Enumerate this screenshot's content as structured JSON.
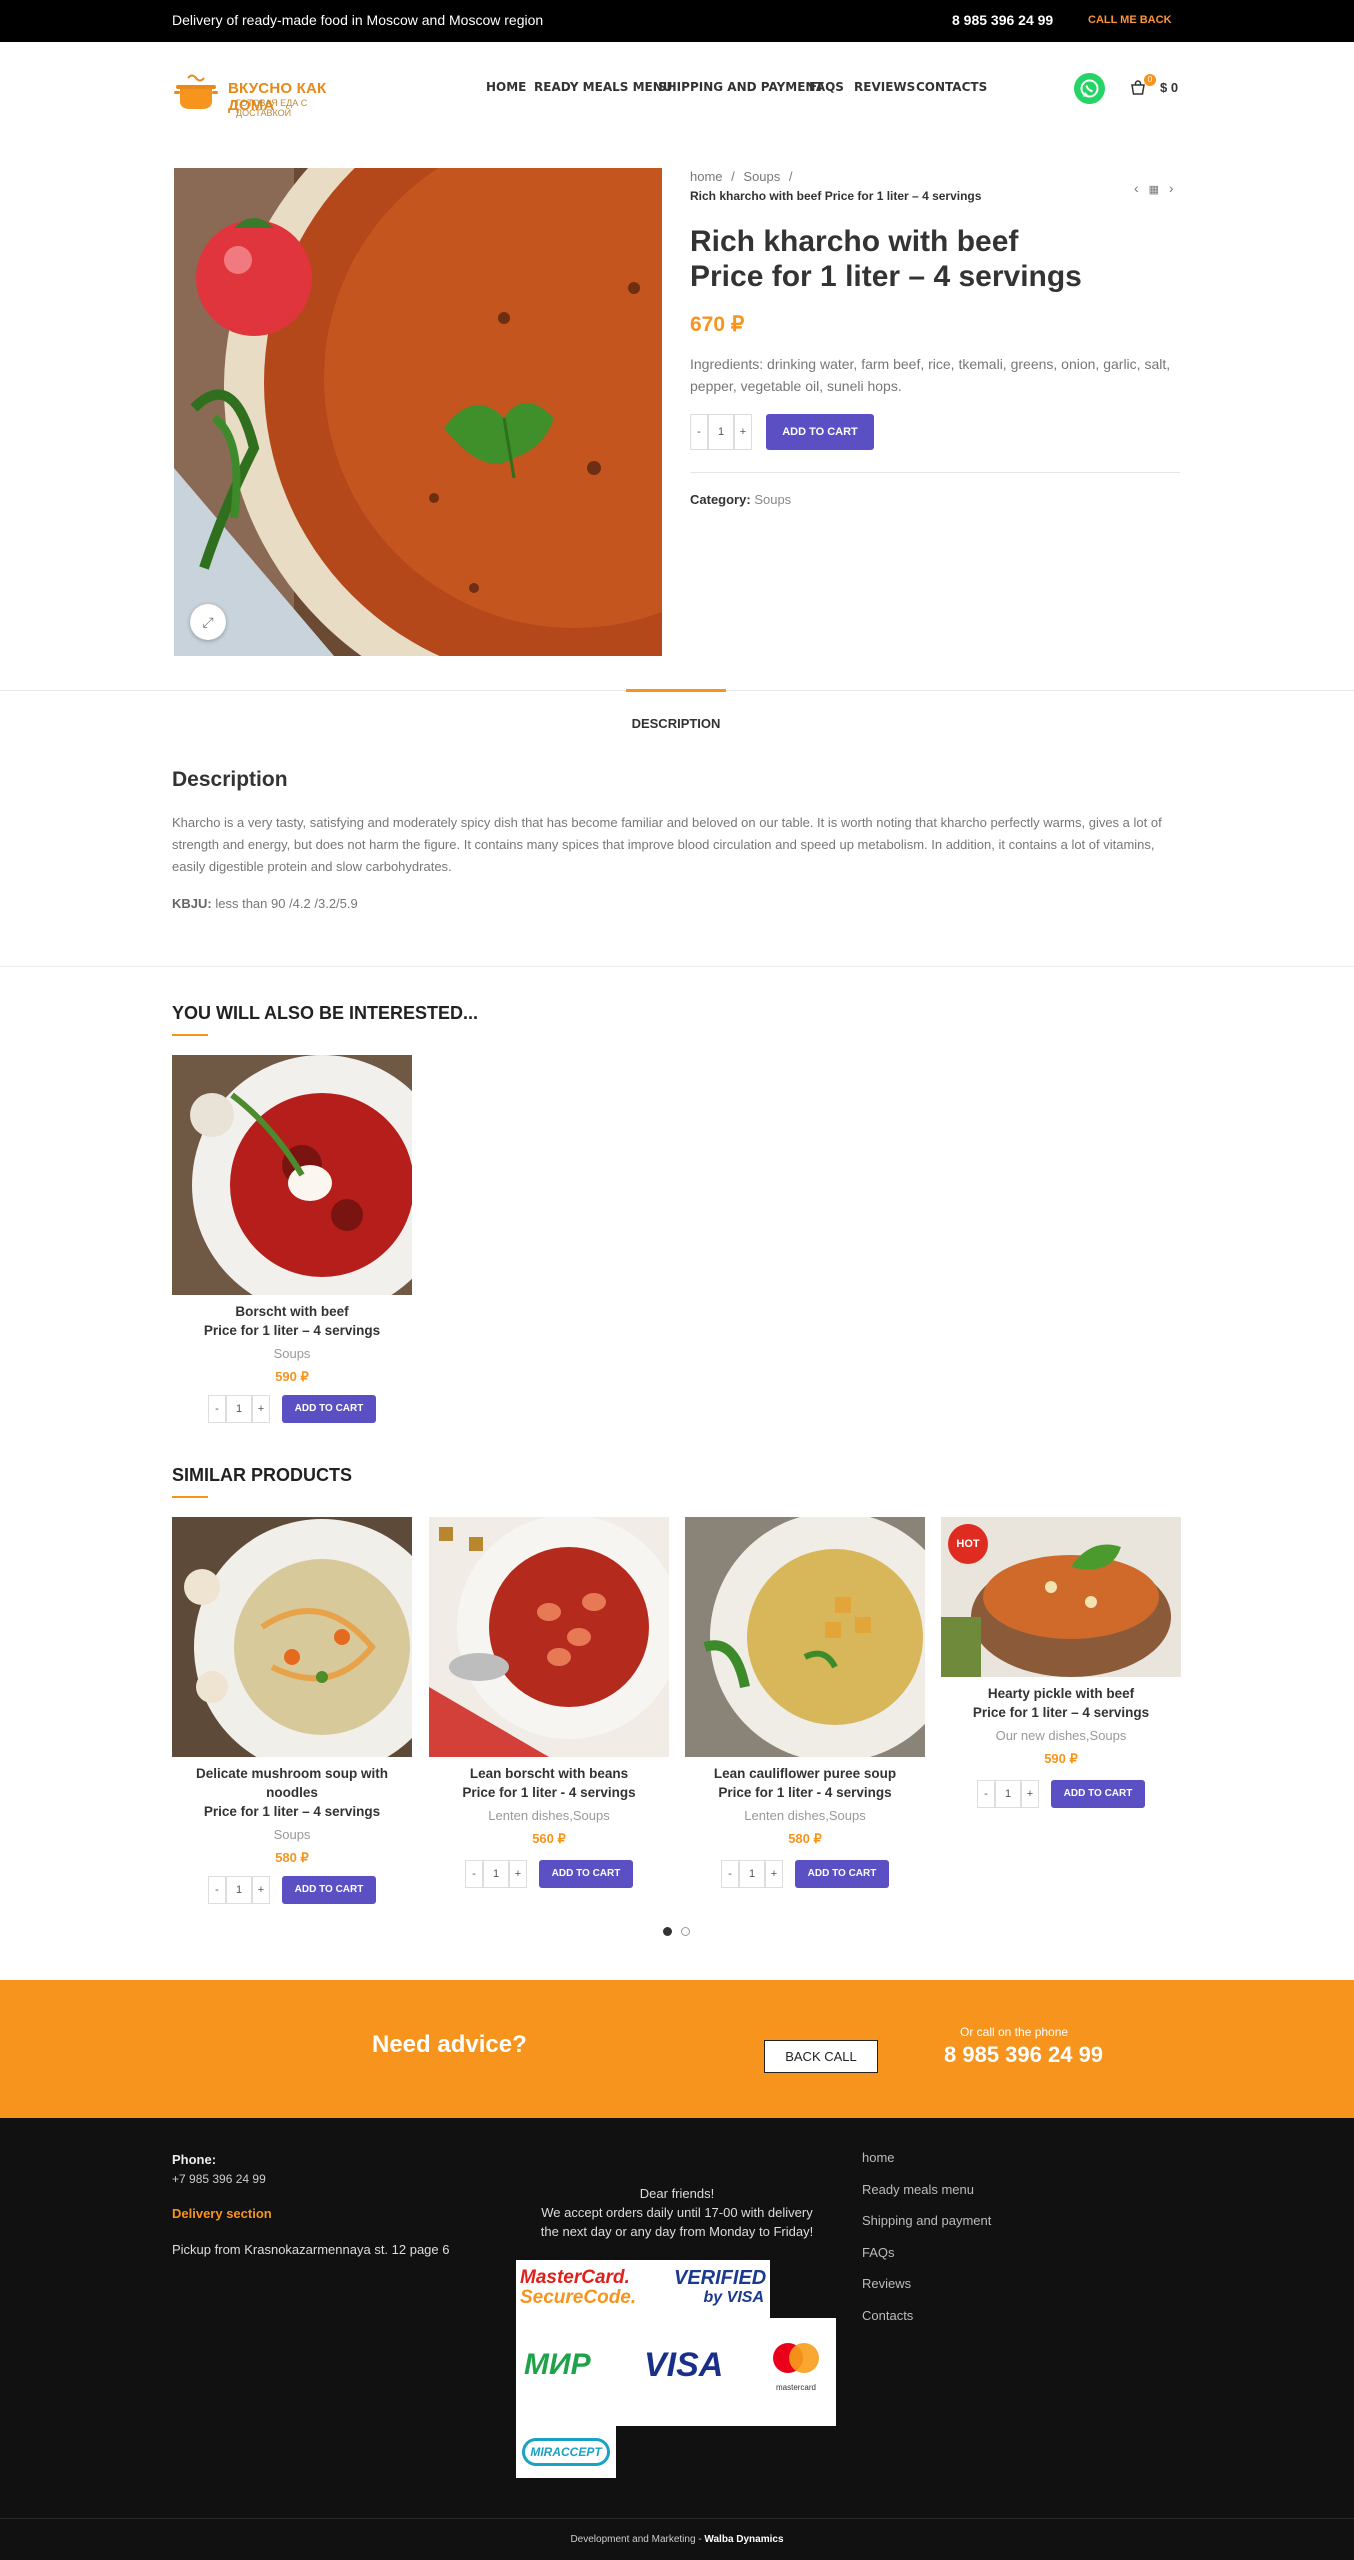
{
  "topbar": {
    "message": "Delivery of ready-made food in Moscow and Moscow region",
    "phone": "8 985 396 24 99",
    "call_me_back": "CALL ME BACK"
  },
  "header": {
    "logo_title": "ВКУСНО КАК ДОМА",
    "logo_subtitle": "ГОТОВАЯ ЕДА С ДОСТАВКОЙ",
    "nav": [
      "HOME",
      "READY MEALS MENU",
      "SHIPPING AND PAYMENT",
      "FAQS",
      "REVIEWS",
      "CONTACTS"
    ],
    "cart_count": "0",
    "cart_total": "$ 0"
  },
  "breadcrumb": {
    "home": "home",
    "sep": "/",
    "category": "Soups",
    "current": "Rich kharcho with beef Price for 1 liter – 4 servings"
  },
  "product": {
    "title_line1": "Rich kharcho with beef",
    "title_line2": "Price for 1 liter – 4 servings",
    "price": "670 ₽",
    "ingredients": "Ingredients: drinking water, farm beef, rice, tkemali, greens, onion, garlic, salt, pepper, vegetable oil, suneli hops.",
    "qty": "1",
    "add_to_cart": "ADD TO CART",
    "category_label": "Category:",
    "category_value": "Soups"
  },
  "tabs": {
    "description": "DESCRIPTION"
  },
  "description": {
    "heading": "Description",
    "text": "Kharcho is a very tasty, satisfying and moderately spicy dish that has become familiar and beloved on our table. It is worth noting that kharcho perfectly warms, gives a lot of strength and energy, but does not harm the figure. It contains many spices that improve blood circulation and speed up metabolism. In addition, it contains a lot of vitamins, easily digestible protein and slow carbohydrates.",
    "kbju_label": "KBJU:",
    "kbju_value": "less than 90 /4.2 /3.2/5.9"
  },
  "interested": {
    "heading": "YOU WILL ALSO BE INTERESTED...",
    "items": [
      {
        "title1": "Borscht with beef",
        "title2": "Price for 1 liter – 4 servings",
        "category": "Soups",
        "price": "590 ₽",
        "qty": "1",
        "button": "ADD TO CART"
      }
    ]
  },
  "similar": {
    "heading": "SIMILAR PRODUCTS",
    "items": [
      {
        "title1": "Delicate mushroom soup with",
        "title2": "noodles",
        "title3": "Price for 1 liter – 4 servings",
        "category": "Soups",
        "price": "580 ₽",
        "qty": "1",
        "button": "ADD TO CART"
      },
      {
        "title1": "Lean borscht with beans",
        "title2": "Price for 1 liter - 4 servings",
        "category": "Lenten dishes,Soups",
        "price": "560 ₽",
        "qty": "1",
        "button": "ADD TO CART"
      },
      {
        "title1": "Lean cauliflower puree soup",
        "title2": "Price for 1 liter - 4 servings",
        "category": "Lenten dishes,Soups",
        "price": "580 ₽",
        "qty": "1",
        "button": "ADD TO CART"
      },
      {
        "title1": "Hearty pickle with beef",
        "title2": "Price for 1 liter – 4 servings",
        "category": "Our new dishes,Soups",
        "price": "590 ₽",
        "qty": "1",
        "button": "ADD TO CART",
        "badge": "HOT"
      }
    ]
  },
  "advice": {
    "question": "Need advice?",
    "button": "BACK CALL",
    "or_call": "Or call on the phone",
    "phone": "8 985 396 24 99"
  },
  "footer": {
    "phone_label": "Phone:",
    "phone": "+7 985 396 24 99",
    "delivery_section": "Delivery section",
    "pickup": "Pickup from Krasnokazarmennaya st. 12 page 6",
    "dear": "Dear friends!",
    "orders_line1": "We accept orders daily until 17-00 with delivery",
    "orders_line2": "the next day or any day from Monday to Friday!",
    "links": [
      "home",
      "Ready meals menu",
      "Shipping and payment",
      "FAQs",
      "Reviews",
      "Contacts"
    ],
    "payment": {
      "mc_line1": "MasterCard.",
      "mc_line2": "SecureCode.",
      "visa_line1": "VERIFIED",
      "visa_line2": "by VISA",
      "mir": "МИР",
      "visa": "VISA",
      "mastercard": "mastercard",
      "mir_accept": "MIRACCEPT"
    },
    "credit_prefix": "Development and Marketing - ",
    "credit_name": "Walba Dynamics"
  },
  "colors": {
    "accent": "#f7941d",
    "button": "#5b4fc4",
    "topbar": "#000000",
    "footer": "#111111",
    "whatsapp": "#25d366",
    "hot": "#e02b20"
  }
}
